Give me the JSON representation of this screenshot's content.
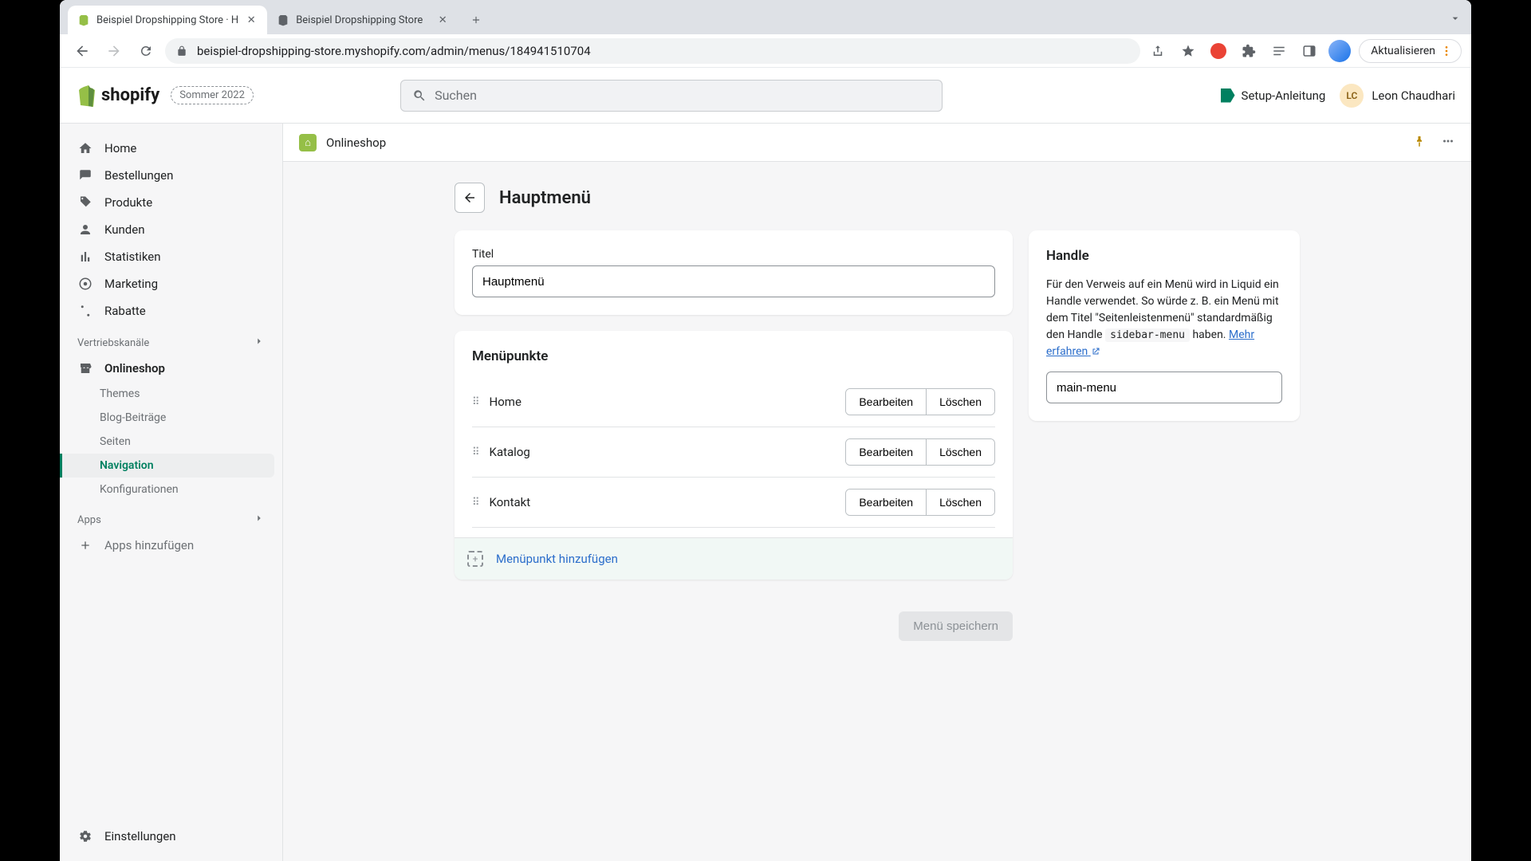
{
  "chrome": {
    "tabs": [
      {
        "title": "Beispiel Dropshipping Store · H",
        "active": true
      },
      {
        "title": "Beispiel Dropshipping Store",
        "active": false
      }
    ],
    "url": "beispiel-dropshipping-store.myshopify.com/admin/menus/184941510704",
    "update_label": "Aktualisieren"
  },
  "header": {
    "brand": "shopify",
    "badge": "Sommer 2022",
    "search_placeholder": "Suchen",
    "setup_guide": "Setup-Anleitung",
    "user_initials": "LC",
    "user_name": "Leon Chaudhari"
  },
  "sidebar": {
    "main": [
      {
        "label": "Home"
      },
      {
        "label": "Bestellungen"
      },
      {
        "label": "Produkte"
      },
      {
        "label": "Kunden"
      },
      {
        "label": "Statistiken"
      },
      {
        "label": "Marketing"
      },
      {
        "label": "Rabatte"
      }
    ],
    "channels_label": "Vertriebskanäle",
    "onlineshop": "Onlineshop",
    "onlineshop_sub": [
      {
        "label": "Themes",
        "active": false
      },
      {
        "label": "Blog-Beiträge",
        "active": false
      },
      {
        "label": "Seiten",
        "active": false
      },
      {
        "label": "Navigation",
        "active": true
      },
      {
        "label": "Konfigurationen",
        "active": false
      }
    ],
    "apps_label": "Apps",
    "apps_add": "Apps hinzufügen",
    "settings": "Einstellungen"
  },
  "subheader": {
    "label": "Onlineshop"
  },
  "page": {
    "title": "Hauptmenü",
    "title_field_label": "Titel",
    "title_value": "Hauptmenü",
    "menu_items_heading": "Menüpunkte",
    "items": [
      {
        "name": "Home"
      },
      {
        "name": "Katalog"
      },
      {
        "name": "Kontakt"
      }
    ],
    "edit_label": "Bearbeiten",
    "delete_label": "Löschen",
    "add_item_label": "Menüpunkt hinzufügen",
    "save_label": "Menü speichern"
  },
  "handle": {
    "heading": "Handle",
    "desc_1": "Für den Verweis auf ein Menü wird in Liquid ein Handle verwendet. So würde z. B. ein Menü mit dem Titel \"Seitenleistenmenü\" standardmäßig den Handle ",
    "code": "sidebar-menu",
    "desc_2": " haben. ",
    "learn_more": "Mehr erfahren",
    "value": "main-menu"
  }
}
